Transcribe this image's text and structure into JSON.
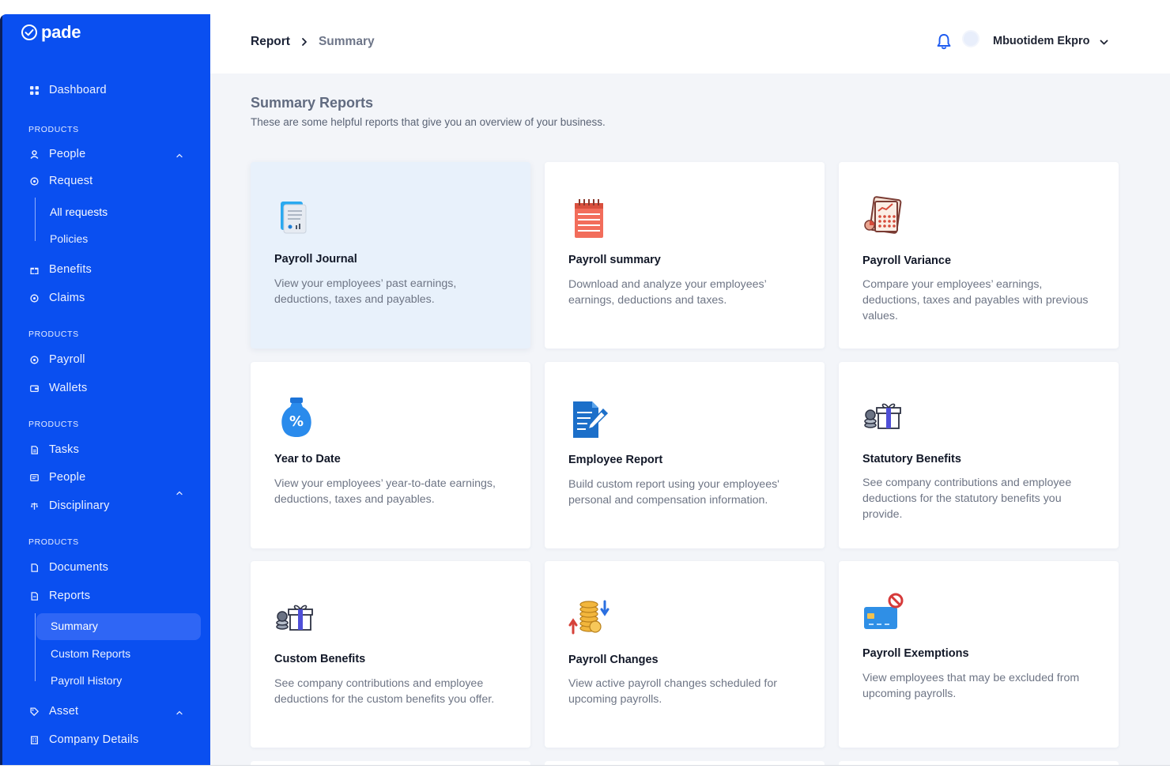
{
  "app": {
    "name": "pade"
  },
  "sidebar": {
    "dashboard": "Dashboard",
    "sections": [
      "PRODUCTS",
      "PRODUCTS",
      "PRODUCTS",
      "PRODUCTS"
    ],
    "items": {
      "people1": "People",
      "request": "Request",
      "all_requests": "All requests",
      "policies": "Policies",
      "benefits": "Benefits",
      "claims": "Claims",
      "payroll": "Payroll",
      "wallets": "Wallets",
      "tasks": "Tasks",
      "people2": "People",
      "disciplinary": "Disciplinary",
      "documents": "Documents",
      "reports": "Reports",
      "summary": "Summary",
      "custom_reports": "Custom Reports",
      "payroll_history": "Payroll History",
      "asset": "Asset",
      "company_details": "Company Details"
    }
  },
  "header": {
    "breadcrumb": [
      "Report",
      "Summary"
    ],
    "user_name": "Mbuotidem Ekpro"
  },
  "main": {
    "title": "Summary Reports",
    "subtitle": "These are some helpful reports that give you an overview of your business."
  },
  "cards": [
    {
      "title": "Payroll Journal",
      "desc": "View your employees’ past earnings, deductions, taxes and payables.",
      "icon": "journal-document-icon"
    },
    {
      "title": "Payroll summary",
      "desc": "Download and analyze your employees’ earnings, deductions and taxes.",
      "icon": "notepad-icon"
    },
    {
      "title": "Payroll Variance",
      "desc": "Compare your employees’ earnings, deductions, taxes and payables with previous values.",
      "icon": "calculator-chart-icon"
    },
    {
      "title": "Year to Date",
      "desc": "View your employees’ year-to-date earnings, deductions, taxes and payables.",
      "icon": "money-bag-percent-icon"
    },
    {
      "title": "Employee Report",
      "desc": "Build custom report using your employees' personal and compensation information.",
      "icon": "document-pen-icon"
    },
    {
      "title": "Statutory Benefits",
      "desc": "See company contributions and employee deductions for the statutory benefits you provide.",
      "icon": "coins-gift-icon"
    },
    {
      "title": "Custom Benefits",
      "desc": "See company contributions and employee deductions for the custom benefits you offer.",
      "icon": "coins-gift-icon"
    },
    {
      "title": "Payroll Changes",
      "desc": "View active payroll changes scheduled for upcoming payrolls.",
      "icon": "coins-arrows-icon"
    },
    {
      "title": "Payroll Exemptions",
      "desc": "View employees that may be excluded from upcoming payrolls.",
      "icon": "card-blocked-icon"
    }
  ],
  "colors": {
    "sidebar": "#0a4ff0",
    "active_item": "#2f66f5",
    "card_active": "#e8f1fb",
    "accent": "#1f5cf0"
  }
}
